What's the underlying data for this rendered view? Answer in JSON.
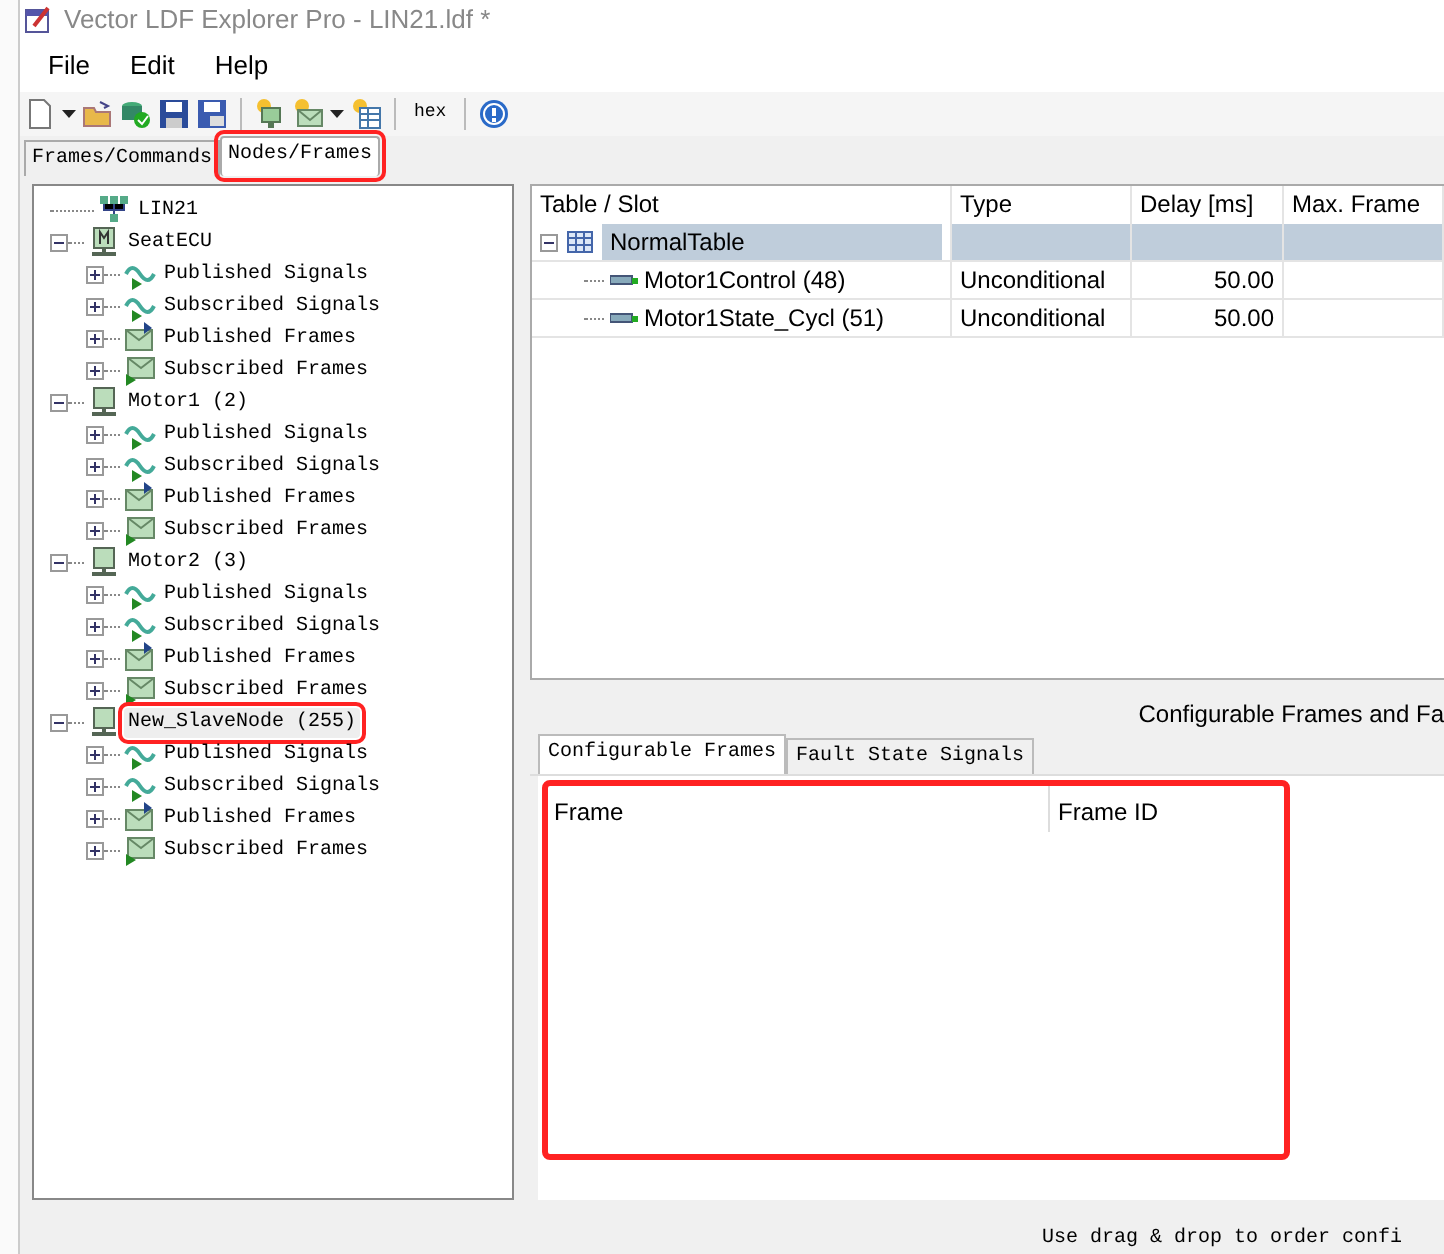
{
  "window": {
    "title": "Vector LDF Explorer Pro - LIN21.ldf *"
  },
  "menu": [
    "File",
    "Edit",
    "Help"
  ],
  "toolbar": [
    {
      "kind": "new",
      "dropdown": true
    },
    {
      "kind": "open"
    },
    {
      "kind": "db-check"
    },
    {
      "kind": "save"
    },
    {
      "kind": "save-as"
    },
    {
      "kind": "sep"
    },
    {
      "kind": "add-node"
    },
    {
      "kind": "add-frame",
      "dropdown": true
    },
    {
      "kind": "add-table"
    },
    {
      "kind": "sep"
    },
    {
      "kind": "text",
      "label": "hex"
    },
    {
      "kind": "sep"
    },
    {
      "kind": "help"
    }
  ],
  "left_tabs": [
    {
      "label": "Frames/Commands",
      "selected": false,
      "highlighted": false
    },
    {
      "label": "Nodes/Frames",
      "selected": true,
      "highlighted": true
    }
  ],
  "tree": [
    {
      "label": "LIN21",
      "kind": "network",
      "highlighted": false
    },
    {
      "label": "SeatECU",
      "kind": "master",
      "expanded": true,
      "highlighted": false,
      "children": [
        {
          "label": "Published Signals",
          "kind": "signal"
        },
        {
          "label": "Subscribed Signals",
          "kind": "signal"
        },
        {
          "label": "Published Frames",
          "kind": "frame-pub"
        },
        {
          "label": "Subscribed Frames",
          "kind": "frame-sub"
        }
      ]
    },
    {
      "label": "Motor1 (2)",
      "kind": "slave",
      "expanded": true,
      "highlighted": false,
      "children": [
        {
          "label": "Published Signals",
          "kind": "signal"
        },
        {
          "label": "Subscribed Signals",
          "kind": "signal"
        },
        {
          "label": "Published Frames",
          "kind": "frame-pub"
        },
        {
          "label": "Subscribed Frames",
          "kind": "frame-sub"
        }
      ]
    },
    {
      "label": "Motor2 (3)",
      "kind": "slave",
      "expanded": true,
      "highlighted": false,
      "children": [
        {
          "label": "Published Signals",
          "kind": "signal"
        },
        {
          "label": "Subscribed Signals",
          "kind": "signal"
        },
        {
          "label": "Published Frames",
          "kind": "frame-pub"
        },
        {
          "label": "Subscribed Frames",
          "kind": "frame-sub"
        }
      ]
    },
    {
      "label": "New_SlaveNode (255)",
      "kind": "slave",
      "expanded": true,
      "highlighted": true,
      "children": [
        {
          "label": "Published Signals",
          "kind": "signal"
        },
        {
          "label": "Subscribed Signals",
          "kind": "signal"
        },
        {
          "label": "Published Frames",
          "kind": "frame-pub"
        },
        {
          "label": "Subscribed Frames",
          "kind": "frame-sub"
        }
      ]
    }
  ],
  "schedule_table": {
    "columns": [
      "Table / Slot",
      "Type",
      "Delay [ms]",
      "Max. Frame"
    ],
    "rows": [
      {
        "kind": "table",
        "cells": [
          "NormalTable"
        ],
        "expanded": true,
        "selected": true
      },
      {
        "kind": "slot",
        "cells": [
          "Motor1Control (48)",
          "Unconditional",
          "50.00"
        ],
        "selected": false
      },
      {
        "kind": "slot",
        "cells": [
          "Motor1State_Cycl (51)",
          "Unconditional",
          "50.00"
        ],
        "selected": false
      }
    ]
  },
  "section_title": "Configurable Frames and Fa",
  "bottom_tabs": [
    {
      "label": "Configurable Frames",
      "selected": true
    },
    {
      "label": "Fault State Signals",
      "selected": false
    }
  ],
  "frames_table": {
    "columns": [
      "Frame",
      "Frame ID"
    ],
    "highlighted": true
  },
  "hint": "Use drag & drop to order confi"
}
